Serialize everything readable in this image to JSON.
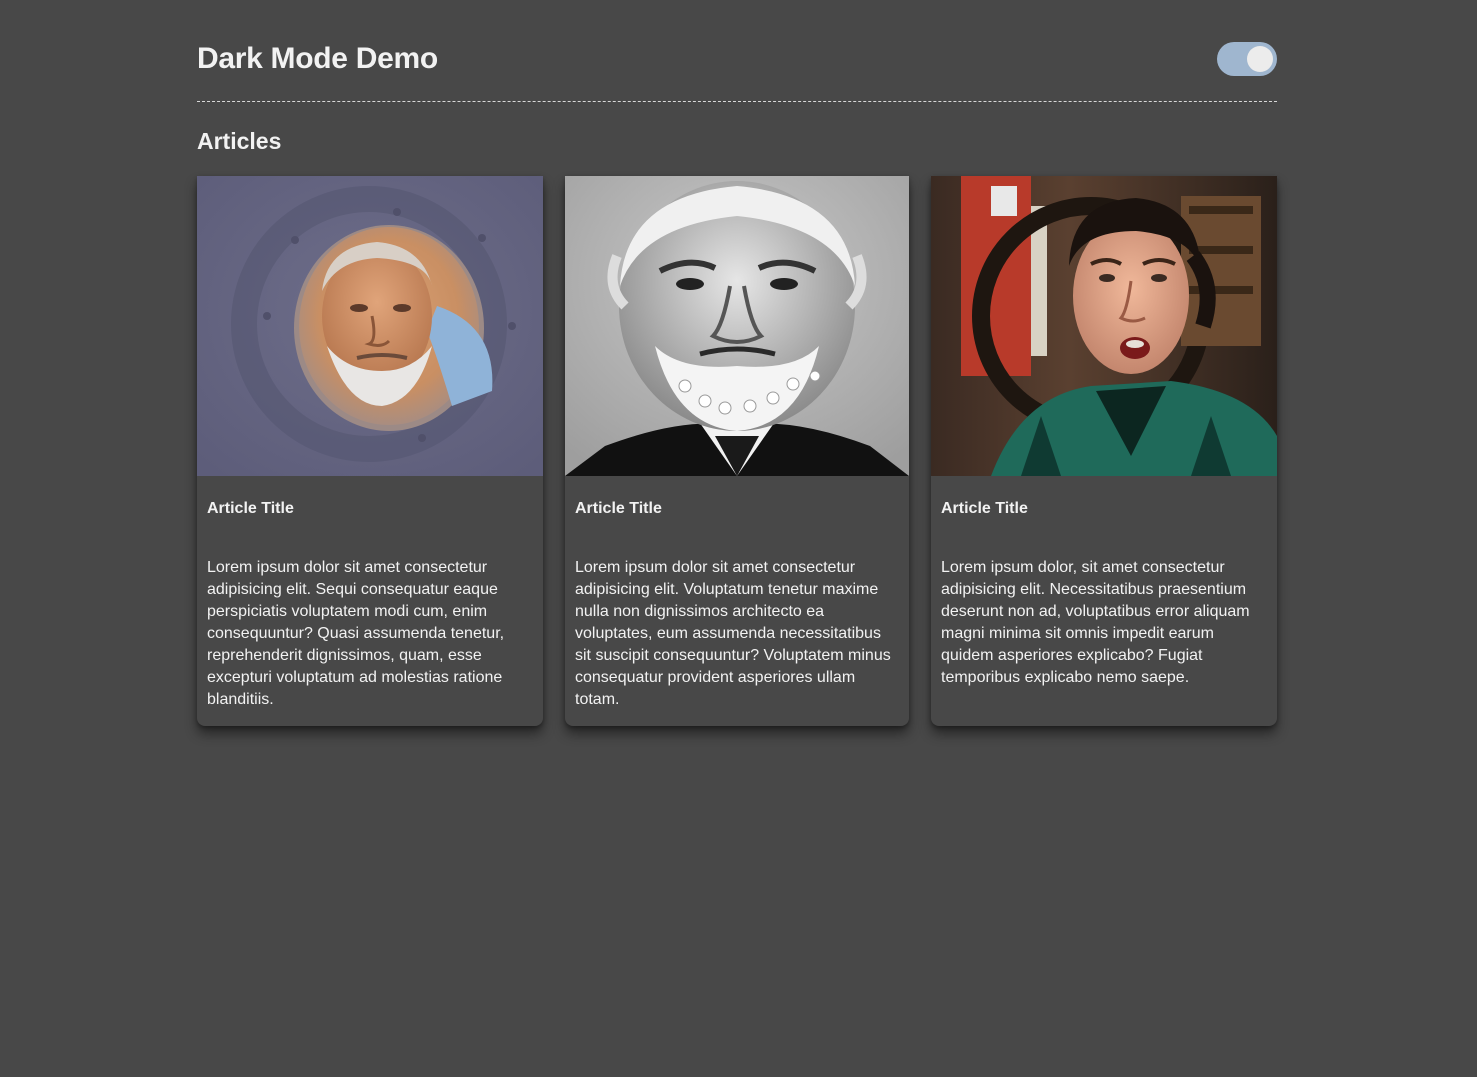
{
  "header": {
    "title": "Dark Mode Demo",
    "toggle_state": "on"
  },
  "section": {
    "title": "Articles"
  },
  "cards": [
    {
      "image_name": "portrait-porthole-photo",
      "title": "Article Title",
      "text": "Lorem ipsum dolor sit amet consectetur adipisicing elit. Sequi consequatur eaque perspiciatis voluptatem modi cum, enim consequuntur? Quasi assumenda tenetur, reprehenderit dignissimos, quam, esse excepturi voluptatum ad molestias ratione blanditiis."
    },
    {
      "image_name": "portrait-black-white-photo",
      "title": "Article Title",
      "text": "Lorem ipsum dolor sit amet consectetur adipisicing elit. Voluptatum tenetur maxime nulla non dignissimos architecto ea voluptates, eum assumenda necessitatibus sit suscipit consequuntur? Voluptatem minus consequatur provident asperiores ullam totam."
    },
    {
      "image_name": "portrait-stage-photo",
      "title": "Article Title",
      "text": "Lorem ipsum dolor, sit amet consectetur adipisicing elit. Necessitatibus praesentium deserunt non ad, voluptatibus error aliquam magni minima sit omnis impedit earum quidem asperiores explicabo? Fugiat temporibus explicabo nemo saepe."
    }
  ],
  "colors": {
    "background": "#484848",
    "text": "#f2f2f2",
    "toggle_track": "#9fb6cf",
    "toggle_knob": "#ececec"
  }
}
